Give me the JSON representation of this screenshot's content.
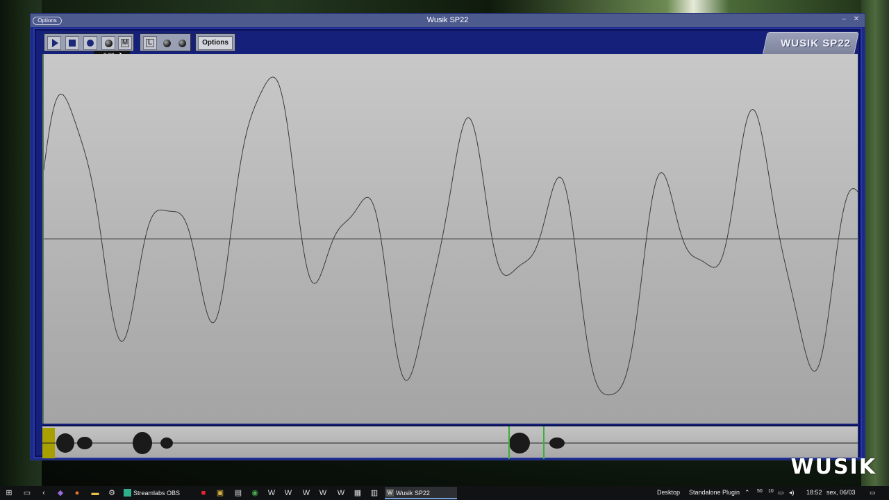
{
  "window": {
    "title": "Wusik SP22",
    "options_chip": "Options"
  },
  "toolbar": {
    "options_label": "Options",
    "m_label": "M",
    "l_label": "L",
    "tooltip_value": "0.00"
  },
  "logo": {
    "text": "WUSIK SP22"
  },
  "watermark": "WUSIK",
  "taskbar": {
    "tasks": [
      "Streamlabs OBS",
      "Wusik SP22"
    ],
    "tray": {
      "desktop": "Desktop",
      "standalone": "Standalone Plugin",
      "num1": "50",
      "num2": "10",
      "time": "18:52",
      "date": "sex, 06/03"
    }
  },
  "icons": {
    "play": "play-icon",
    "stop": "stop-icon",
    "record": "record-icon",
    "knob": "knob-icon"
  },
  "colors": {
    "window_frame": "#1b2a8a",
    "waveform_bg": "#b8b8b8",
    "waveform_line": "#3a3a3a",
    "selection_marker": "#3cae3c",
    "start_marker": "#a8a000"
  }
}
